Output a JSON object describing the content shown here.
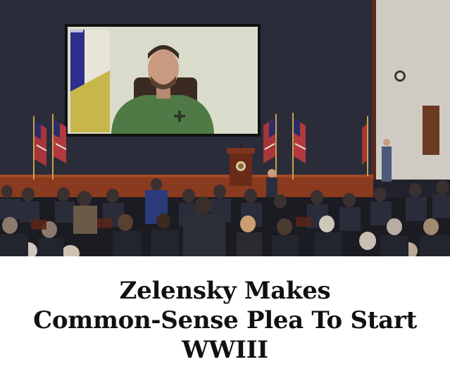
{
  "article": {
    "headline_lines": [
      "Zelensky Makes",
      "Common-Sense Plea To Start",
      "WWIII"
    ]
  },
  "photo": {
    "subject": "video-address-in-auditorium"
  },
  "colors": {
    "background": "#ffffff",
    "headline_text": "#111111",
    "stage_wall": "#2a2a38",
    "stage_floor": "#8a3a1e",
    "screen_bg": "#d9dccb",
    "shirt": "#4f7a45"
  }
}
